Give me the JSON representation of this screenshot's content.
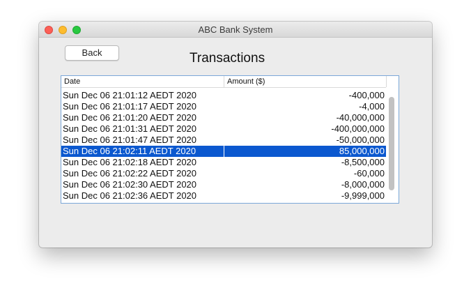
{
  "window": {
    "title": "ABC Bank System"
  },
  "toolbar": {
    "back_label": "Back"
  },
  "page": {
    "heading": "Transactions"
  },
  "table": {
    "columns": [
      "Date",
      "Amount ($)"
    ],
    "selected_index": 5,
    "rows": [
      {
        "date": "Sun Dec 06 21:01:12 AEDT 2020",
        "amount": "-400,000"
      },
      {
        "date": "Sun Dec 06 21:01:17 AEDT 2020",
        "amount": "-4,000"
      },
      {
        "date": "Sun Dec 06 21:01:20 AEDT 2020",
        "amount": "-40,000,000"
      },
      {
        "date": "Sun Dec 06 21:01:31 AEDT 2020",
        "amount": "-400,000,000"
      },
      {
        "date": "Sun Dec 06 21:01:47 AEDT 2020",
        "amount": "-50,000,000"
      },
      {
        "date": "Sun Dec 06 21:02:11 AEDT 2020",
        "amount": "85,000,000"
      },
      {
        "date": "Sun Dec 06 21:02:18 AEDT 2020",
        "amount": "-8,500,000"
      },
      {
        "date": "Sun Dec 06 21:02:22 AEDT 2020",
        "amount": "-60,000"
      },
      {
        "date": "Sun Dec 06 21:02:30 AEDT 2020",
        "amount": "-8,000,000"
      },
      {
        "date": "Sun Dec 06 21:02:36 AEDT 2020",
        "amount": "-9,999,000"
      }
    ]
  },
  "colors": {
    "selection": "#0b58cf",
    "table_border": "#7aa7d8",
    "close": "#fc5f57",
    "minimize": "#fdbc2e",
    "maximize": "#28c840"
  }
}
